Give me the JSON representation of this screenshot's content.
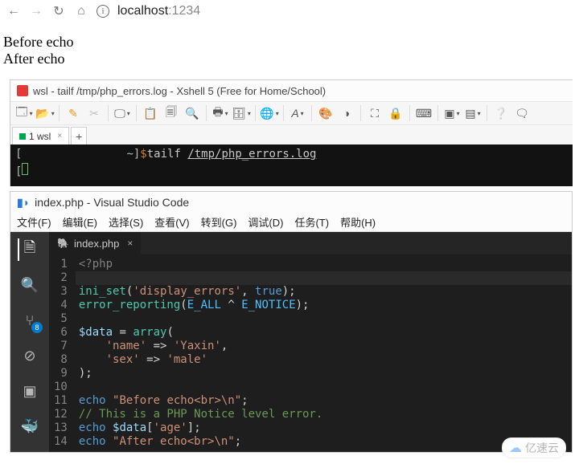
{
  "browser": {
    "address_host": "localhost",
    "address_port": ":1234"
  },
  "page": {
    "line1": "Before echo",
    "line2": "After echo"
  },
  "xshell": {
    "title": "wsl - tailf /tmp/php_errors.log - Xshell 5 (Free for Home/School)",
    "tab_label": "1 wsl",
    "prompt_left": "[",
    "prompt_mid": "~]",
    "prompt_dollar": "$",
    "cmd": "tailf ",
    "cmd_path": "/tmp/php_errors.log"
  },
  "vscode": {
    "title": "index.php - Visual Studio Code",
    "menu": [
      "文件(F)",
      "编辑(E)",
      "选择(S)",
      "查看(V)",
      "转到(G)",
      "调试(D)",
      "任务(T)",
      "帮助(H)"
    ],
    "tab_label": "index.php",
    "scm_badge": "8",
    "code": {
      "l1_open": "<?php",
      "l3_fn": "ini_set",
      "l3_s1": "'display_errors'",
      "l3_s2": "true",
      "l4_fn": "error_reporting",
      "l4_c1": "E_ALL",
      "l4_c2": "E_NOTICE",
      "l6_var": "$data",
      "l6_fn": "array",
      "l7_k": "'name'",
      "l7_v": "'Yaxin'",
      "l8_k": "'sex'",
      "l8_v": "'male'",
      "l11_kw": "echo",
      "l11_s": "\"Before echo<br>\\n\"",
      "l12_cm": "// This is a PHP Notice level error.",
      "l13_kw": "echo",
      "l13_var": "$data",
      "l13_idx": "'age'",
      "l14_kw": "echo",
      "l14_s": "\"After echo<br>\\n\""
    }
  },
  "watermark": "亿速云"
}
